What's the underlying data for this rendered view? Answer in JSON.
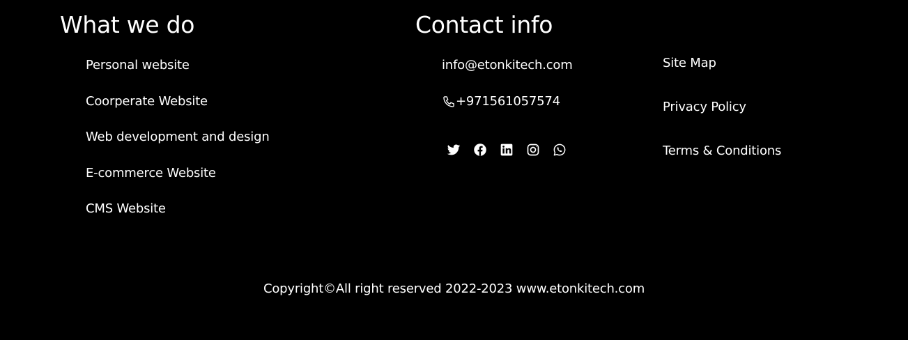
{
  "what_we_do": {
    "title": "What we do",
    "items": [
      "Personal website",
      "Coorperate Website",
      "Web development and design",
      "E-commerce Website",
      "CMS Website"
    ]
  },
  "contact": {
    "title": "Contact info",
    "email": "info@etonkitech.com",
    "phone": "+971561057574",
    "phone_icon": "phone-icon",
    "socials": [
      "twitter-icon",
      "facebook-icon",
      "linkedin-icon",
      "instagram-icon",
      "whatsapp-icon"
    ]
  },
  "legal": {
    "items": [
      "Site Map",
      "Privacy Policy",
      "Terms & Conditions"
    ]
  },
  "copyright": "Copyright©All right reserved 2022-2023 www.etonkitech.com",
  "colors": {
    "background": "#000000",
    "text": "#ffffff"
  }
}
